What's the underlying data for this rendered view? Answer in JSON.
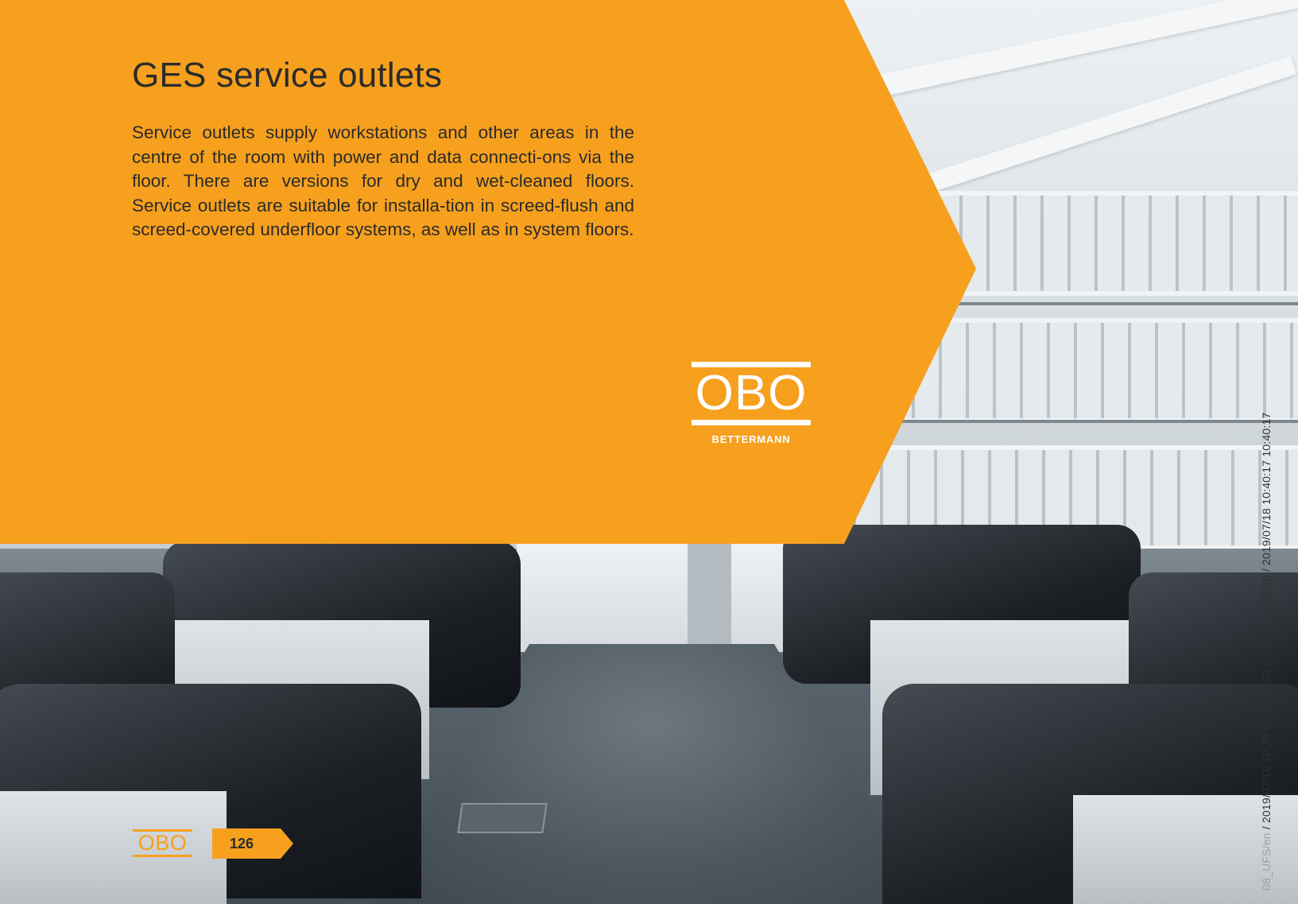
{
  "heading": "GES service outlets",
  "body": "Service outlets supply workstations and other areas in the centre of the room with power and data connecti-ons via the floor. There are versions for dry and wet-cleaned floors. Service outlets are suitable for installa-tion in screed-flush and screed-covered underfloor systems, as well as in system floors.",
  "logo": {
    "word": "OBO",
    "subtitle": "BETTERMANN"
  },
  "footer": {
    "logo_word": "OBO",
    "page_number": "126"
  },
  "slug": {
    "faint": "08_UFS/en",
    "main": "/ 2019/07/18 10:39:53 10:39:53 (LLExport_02520) / 2019/07/18 10:40:17 10:40:17"
  },
  "colors": {
    "brand_orange": "#f6a01e",
    "text": "#2b2b2b",
    "white": "#ffffff"
  }
}
